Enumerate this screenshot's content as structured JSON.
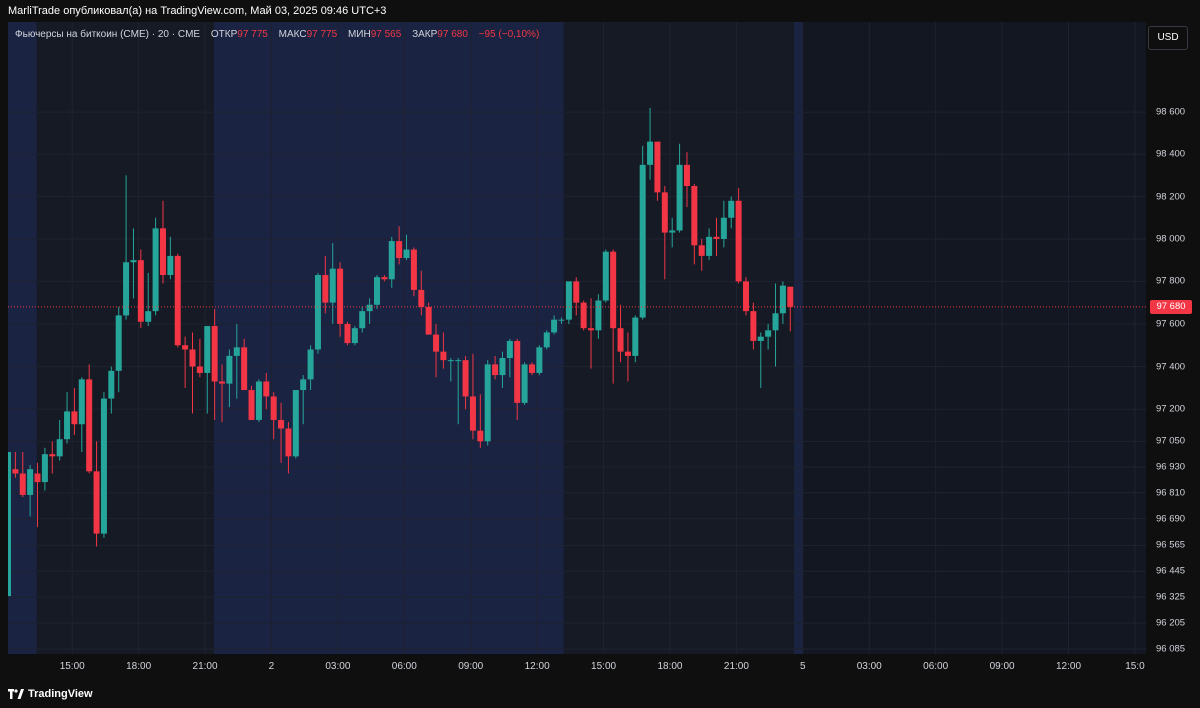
{
  "header": {
    "publish_line": "MarliTrade опубликовал(а) на TradingView.com, Май 03, 2025 09:46 UTC+3"
  },
  "legend": {
    "symbol": "Фьючерсы на биткоин (CME) · 20 · CME",
    "open_label": "ОТКР",
    "open_value": "97 775",
    "high_label": "МАКС",
    "high_value": "97 775",
    "low_label": "МИН",
    "low_value": "97 565",
    "close_label": "ЗАКР",
    "close_value": "97 680",
    "change": "−95 (−0,10%)"
  },
  "currency_button": "USD",
  "footer": {
    "brand": "TradingView"
  },
  "colors": {
    "up": "#26a69a",
    "down": "#f23645",
    "background": "#131722",
    "session_shade": "#1a2341",
    "grid": "#1f2330",
    "last_price_line": "#f23645"
  },
  "chart_data": {
    "type": "candlestick",
    "interval_minutes": 20,
    "currency": "USD",
    "y_scale": "log",
    "ylim": [
      96085,
      98800
    ],
    "price_ticks": [
      "98 600",
      "98 400",
      "98 200",
      "98 000",
      "97 800",
      "97 600",
      "97 400",
      "97 200",
      "97 050",
      "96 930",
      "96 810",
      "96 690",
      "96 565",
      "96 445",
      "96 325",
      "96 205",
      "96 085"
    ],
    "price_tick_values": [
      98600,
      98400,
      98200,
      98000,
      97800,
      97600,
      97400,
      97200,
      97050,
      96930,
      96810,
      96690,
      96565,
      96445,
      96325,
      96205,
      96085
    ],
    "time_ticks": [
      {
        "label": "15:00",
        "hour": 15
      },
      {
        "label": "18:00",
        "hour": 18
      },
      {
        "label": "21:00",
        "hour": 21
      },
      {
        "label": "2",
        "hour": 24
      },
      {
        "label": "03:00",
        "hour": 27
      },
      {
        "label": "06:00",
        "hour": 30
      },
      {
        "label": "09:00",
        "hour": 33
      },
      {
        "label": "12:00",
        "hour": 36
      },
      {
        "label": "15:00",
        "hour": 39
      },
      {
        "label": "18:00",
        "hour": 42
      },
      {
        "label": "21:00",
        "hour": 45
      },
      {
        "label": "5",
        "hour": 48
      },
      {
        "label": "03:00",
        "hour": 51
      },
      {
        "label": "06:00",
        "hour": 54
      },
      {
        "label": "09:00",
        "hour": 57
      },
      {
        "label": "12:00",
        "hour": 60
      },
      {
        "label": "15:0",
        "hour": 63
      }
    ],
    "x_range_hours": [
      12.1,
      63.5
    ],
    "session_shading_hours": [
      [
        12.1,
        13.4
      ],
      [
        13.4,
        15.5
      ],
      [
        21.4,
        37.2
      ],
      [
        47.6,
        48.0
      ]
    ],
    "session_darker_hours": [
      [
        13.4,
        15.5
      ],
      [
        15.5,
        21.4
      ],
      [
        37.2,
        47.6
      ]
    ],
    "last_price": 97680,
    "last_price_label": "97 680",
    "candles": [
      {
        "o": 96330,
        "h": 97000,
        "l": 96330,
        "c": 97000
      },
      {
        "o": 96920,
        "h": 97000,
        "l": 96880,
        "c": 96900
      },
      {
        "o": 96900,
        "h": 97000,
        "l": 96790,
        "c": 96800
      },
      {
        "o": 96800,
        "h": 96940,
        "l": 96700,
        "c": 96920
      },
      {
        "o": 96900,
        "h": 96950,
        "l": 96650,
        "c": 96860
      },
      {
        "o": 96860,
        "h": 97020,
        "l": 96820,
        "c": 96990
      },
      {
        "o": 96990,
        "h": 97050,
        "l": 96900,
        "c": 96980
      },
      {
        "o": 96980,
        "h": 97150,
        "l": 96960,
        "c": 97060
      },
      {
        "o": 97060,
        "h": 97280,
        "l": 97040,
        "c": 97190
      },
      {
        "o": 97190,
        "h": 97300,
        "l": 97080,
        "c": 97130
      },
      {
        "o": 97130,
        "h": 97350,
        "l": 97000,
        "c": 97340
      },
      {
        "o": 97340,
        "h": 97410,
        "l": 96900,
        "c": 96910
      },
      {
        "o": 96910,
        "h": 97050,
        "l": 96560,
        "c": 96620
      },
      {
        "o": 96620,
        "h": 97280,
        "l": 96600,
        "c": 97250
      },
      {
        "o": 97250,
        "h": 97400,
        "l": 97180,
        "c": 97380
      },
      {
        "o": 97380,
        "h": 97680,
        "l": 97280,
        "c": 97640
      },
      {
        "o": 97640,
        "h": 98300,
        "l": 97620,
        "c": 97890
      },
      {
        "o": 97890,
        "h": 98050,
        "l": 97720,
        "c": 97900
      },
      {
        "o": 97900,
        "h": 97950,
        "l": 97580,
        "c": 97610
      },
      {
        "o": 97610,
        "h": 97840,
        "l": 97590,
        "c": 97660
      },
      {
        "o": 97660,
        "h": 98100,
        "l": 97640,
        "c": 98050
      },
      {
        "o": 98050,
        "h": 98180,
        "l": 97790,
        "c": 97830
      },
      {
        "o": 97830,
        "h": 98010,
        "l": 97810,
        "c": 97920
      },
      {
        "o": 97920,
        "h": 97930,
        "l": 97490,
        "c": 97500
      },
      {
        "o": 97500,
        "h": 97540,
        "l": 97300,
        "c": 97480
      },
      {
        "o": 97480,
        "h": 97560,
        "l": 97180,
        "c": 97400
      },
      {
        "o": 97400,
        "h": 97530,
        "l": 97350,
        "c": 97370
      },
      {
        "o": 97370,
        "h": 97590,
        "l": 97180,
        "c": 97590
      },
      {
        "o": 97590,
        "h": 97670,
        "l": 97150,
        "c": 97330
      },
      {
        "o": 97330,
        "h": 97410,
        "l": 97140,
        "c": 97320
      },
      {
        "o": 97320,
        "h": 97480,
        "l": 97210,
        "c": 97450
      },
      {
        "o": 97450,
        "h": 97600,
        "l": 97250,
        "c": 97490
      },
      {
        "o": 97490,
        "h": 97530,
        "l": 97300,
        "c": 97290
      },
      {
        "o": 97290,
        "h": 97310,
        "l": 97150,
        "c": 97150
      },
      {
        "o": 97150,
        "h": 97340,
        "l": 97140,
        "c": 97330
      },
      {
        "o": 97330,
        "h": 97370,
        "l": 97200,
        "c": 97260
      },
      {
        "o": 97260,
        "h": 97280,
        "l": 97060,
        "c": 97150
      },
      {
        "o": 97150,
        "h": 97230,
        "l": 96950,
        "c": 97110
      },
      {
        "o": 97110,
        "h": 97140,
        "l": 96900,
        "c": 96980
      },
      {
        "o": 96980,
        "h": 97290,
        "l": 96970,
        "c": 97290
      },
      {
        "o": 97290,
        "h": 97360,
        "l": 97130,
        "c": 97340
      },
      {
        "o": 97340,
        "h": 97500,
        "l": 97290,
        "c": 97480
      },
      {
        "o": 97480,
        "h": 97840,
        "l": 97460,
        "c": 97830
      },
      {
        "o": 97830,
        "h": 97920,
        "l": 97650,
        "c": 97700
      },
      {
        "o": 97700,
        "h": 97980,
        "l": 97600,
        "c": 97860
      },
      {
        "o": 97860,
        "h": 97890,
        "l": 97540,
        "c": 97600
      },
      {
        "o": 97600,
        "h": 97610,
        "l": 97500,
        "c": 97510
      },
      {
        "o": 97510,
        "h": 97590,
        "l": 97500,
        "c": 97580
      },
      {
        "o": 97580,
        "h": 97680,
        "l": 97560,
        "c": 97660
      },
      {
        "o": 97660,
        "h": 97720,
        "l": 97600,
        "c": 97690
      },
      {
        "o": 97690,
        "h": 97830,
        "l": 97670,
        "c": 97820
      },
      {
        "o": 97820,
        "h": 97830,
        "l": 97800,
        "c": 97810
      },
      {
        "o": 97810,
        "h": 98010,
        "l": 97770,
        "c": 97990
      },
      {
        "o": 97990,
        "h": 98060,
        "l": 97880,
        "c": 97910
      },
      {
        "o": 97910,
        "h": 98020,
        "l": 97900,
        "c": 97950
      },
      {
        "o": 97950,
        "h": 97960,
        "l": 97730,
        "c": 97760
      },
      {
        "o": 97760,
        "h": 97850,
        "l": 97640,
        "c": 97680
      },
      {
        "o": 97680,
        "h": 97700,
        "l": 97550,
        "c": 97550
      },
      {
        "o": 97550,
        "h": 97600,
        "l": 97350,
        "c": 97470
      },
      {
        "o": 97470,
        "h": 97560,
        "l": 97390,
        "c": 97430
      },
      {
        "o": 97430,
        "h": 97440,
        "l": 97330,
        "c": 97430
      },
      {
        "o": 97430,
        "h": 97440,
        "l": 97130,
        "c": 97430
      },
      {
        "o": 97430,
        "h": 97450,
        "l": 97200,
        "c": 97260
      },
      {
        "o": 97260,
        "h": 97460,
        "l": 97060,
        "c": 97100
      },
      {
        "o": 97100,
        "h": 97270,
        "l": 97020,
        "c": 97050
      },
      {
        "o": 97050,
        "h": 97430,
        "l": 97030,
        "c": 97410
      },
      {
        "o": 97410,
        "h": 97450,
        "l": 97340,
        "c": 97360
      },
      {
        "o": 97360,
        "h": 97470,
        "l": 97300,
        "c": 97440
      },
      {
        "o": 97440,
        "h": 97530,
        "l": 97350,
        "c": 97520
      },
      {
        "o": 97520,
        "h": 97530,
        "l": 97150,
        "c": 97230
      },
      {
        "o": 97230,
        "h": 97420,
        "l": 97220,
        "c": 97410
      },
      {
        "o": 97410,
        "h": 97420,
        "l": 97360,
        "c": 97370
      },
      {
        "o": 97370,
        "h": 97500,
        "l": 97360,
        "c": 97490
      },
      {
        "o": 97490,
        "h": 97570,
        "l": 97480,
        "c": 97560
      },
      {
        "o": 97560,
        "h": 97640,
        "l": 97550,
        "c": 97620
      },
      {
        "o": 97620,
        "h": 97630,
        "l": 97600,
        "c": 97620
      },
      {
        "o": 97620,
        "h": 97800,
        "l": 97600,
        "c": 97800
      },
      {
        "o": 97800,
        "h": 97820,
        "l": 97640,
        "c": 97700
      },
      {
        "o": 97700,
        "h": 97710,
        "l": 97570,
        "c": 97580
      },
      {
        "o": 97580,
        "h": 97720,
        "l": 97390,
        "c": 97570
      },
      {
        "o": 97570,
        "h": 97740,
        "l": 97530,
        "c": 97710
      },
      {
        "o": 97710,
        "h": 97950,
        "l": 97700,
        "c": 97940
      },
      {
        "o": 97940,
        "h": 97950,
        "l": 97320,
        "c": 97580
      },
      {
        "o": 97580,
        "h": 97690,
        "l": 97420,
        "c": 97470
      },
      {
        "o": 97470,
        "h": 97560,
        "l": 97330,
        "c": 97450
      },
      {
        "o": 97450,
        "h": 97640,
        "l": 97420,
        "c": 97630
      },
      {
        "o": 97630,
        "h": 98440,
        "l": 97620,
        "c": 98350
      },
      {
        "o": 98350,
        "h": 98620,
        "l": 98280,
        "c": 98460
      },
      {
        "o": 98460,
        "h": 98450,
        "l": 98180,
        "c": 98220
      },
      {
        "o": 98220,
        "h": 98250,
        "l": 97810,
        "c": 98030
      },
      {
        "o": 98030,
        "h": 98100,
        "l": 97960,
        "c": 98040
      },
      {
        "o": 98040,
        "h": 98450,
        "l": 98030,
        "c": 98350
      },
      {
        "o": 98350,
        "h": 98410,
        "l": 98150,
        "c": 98250
      },
      {
        "o": 98250,
        "h": 98260,
        "l": 97880,
        "c": 97970
      },
      {
        "o": 97970,
        "h": 98000,
        "l": 97850,
        "c": 97920
      },
      {
        "o": 97920,
        "h": 98050,
        "l": 97900,
        "c": 98010
      },
      {
        "o": 98010,
        "h": 98100,
        "l": 97920,
        "c": 98000
      },
      {
        "o": 98000,
        "h": 98180,
        "l": 97960,
        "c": 98100
      },
      {
        "o": 98100,
        "h": 98200,
        "l": 98050,
        "c": 98180
      },
      {
        "o": 98180,
        "h": 98240,
        "l": 97790,
        "c": 97800
      },
      {
        "o": 97800,
        "h": 97820,
        "l": 97640,
        "c": 97660
      },
      {
        "o": 97660,
        "h": 97700,
        "l": 97480,
        "c": 97520
      },
      {
        "o": 97520,
        "h": 97560,
        "l": 97300,
        "c": 97540
      },
      {
        "o": 97540,
        "h": 97600,
        "l": 97480,
        "c": 97570
      },
      {
        "o": 97570,
        "h": 97790,
        "l": 97400,
        "c": 97650
      },
      {
        "o": 97650,
        "h": 97800,
        "l": 97600,
        "c": 97780
      },
      {
        "o": 97775,
        "h": 97775,
        "l": 97565,
        "c": 97680
      }
    ]
  }
}
